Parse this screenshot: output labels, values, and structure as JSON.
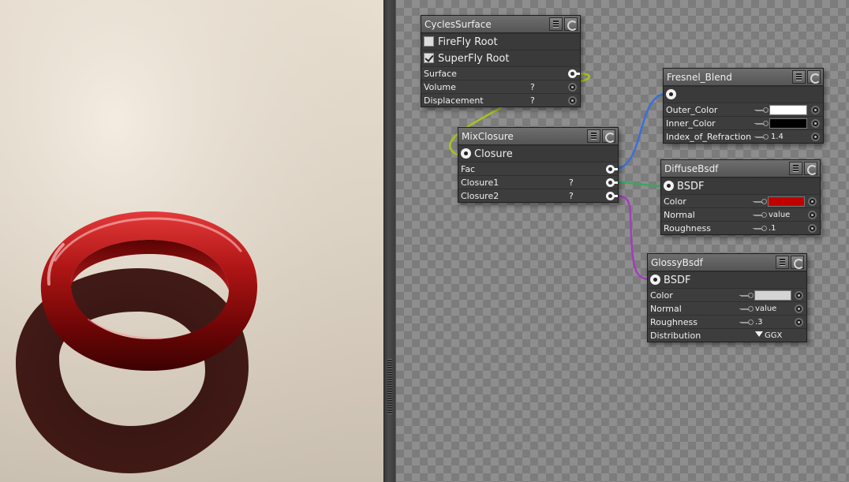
{
  "colors": {
    "wire_surface": "#a8c41e",
    "wire_fac": "#3a6fd8",
    "wire_closure1": "#3aa860",
    "wire_closure2": "#a43cc0",
    "diffuse_color": "#c00000",
    "outer_color": "#ffffff",
    "inner_color": "#000000",
    "glossy_color": "#d4d4d4"
  },
  "nodes": {
    "cycles_surface": {
      "title": "CyclesSurface",
      "firefly_label": "FireFly Root",
      "firefly_checked": false,
      "superfly_label": "SuperFly Root",
      "superfly_checked": true,
      "rows": {
        "surface": "Surface",
        "volume": "Volume",
        "displacement": "Displacement"
      },
      "unknown": "?"
    },
    "mix_closure": {
      "title": "MixClosure",
      "output": "Closure",
      "rows": {
        "fac": "Fac",
        "closure1": "Closure1",
        "closure2": "Closure2"
      },
      "unknown": "?"
    },
    "fresnel_blend": {
      "title": "Fresnel_Blend",
      "rows": {
        "outer": "Outer_Color",
        "inner": "Inner_Color",
        "ior": "Index_of_Refraction"
      },
      "ior_value": "1.4"
    },
    "diffuse_bsdf": {
      "title": "DiffuseBsdf",
      "output": "BSDF",
      "rows": {
        "color": "Color",
        "normal": "Normal",
        "roughness": "Roughness"
      },
      "normal_value": "value",
      "roughness_value": ".1"
    },
    "glossy_bsdf": {
      "title": "GlossyBsdf",
      "output": "BSDF",
      "rows": {
        "color": "Color",
        "normal": "Normal",
        "roughness": "Roughness",
        "distribution": "Distribution"
      },
      "normal_value": "value",
      "roughness_value": ".3",
      "distribution_value": "GGX"
    }
  }
}
